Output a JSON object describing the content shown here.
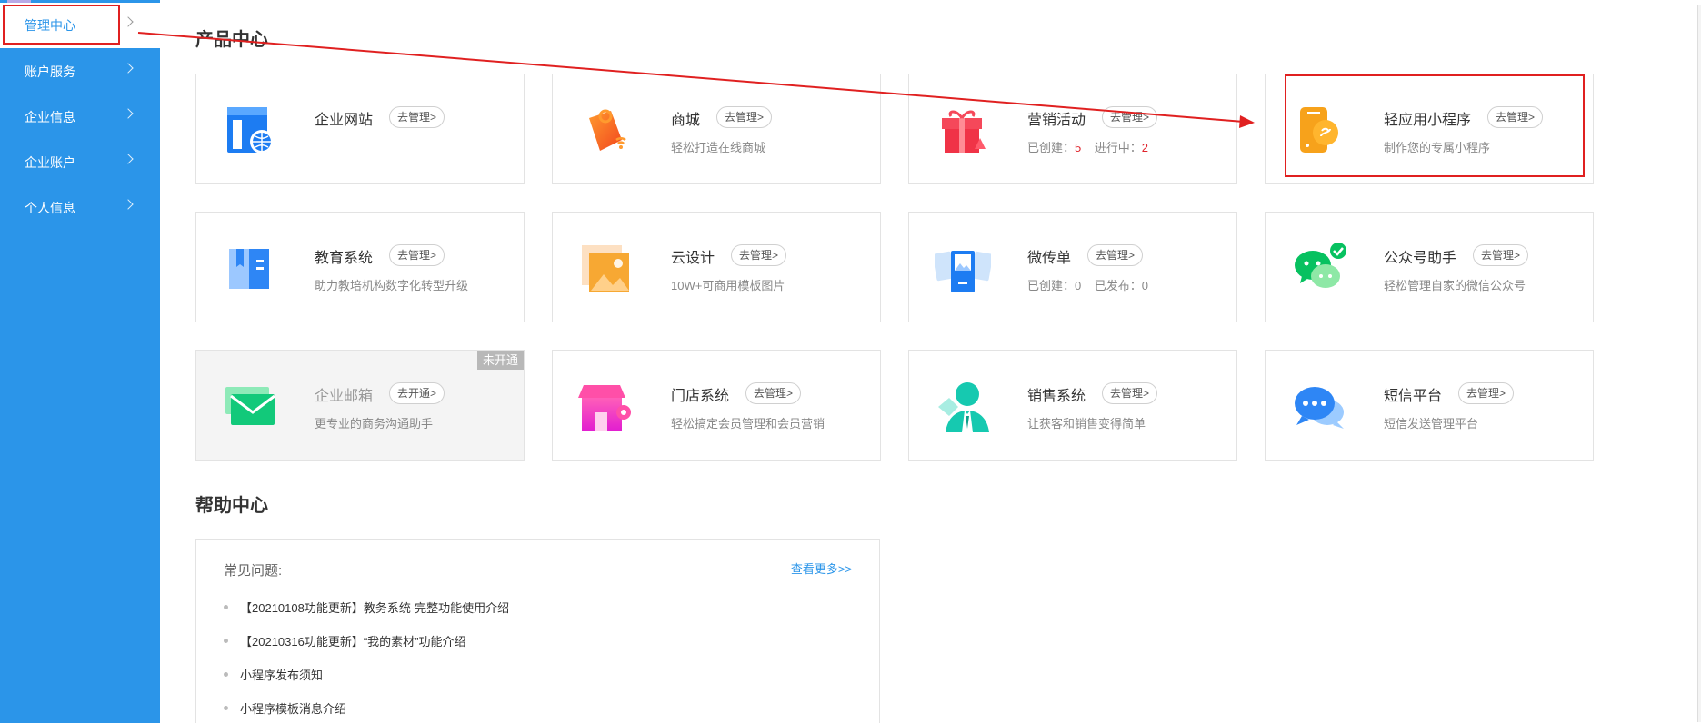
{
  "sidebar": {
    "items": [
      {
        "label": "管理中心"
      },
      {
        "label": "账户服务"
      },
      {
        "label": "企业信息"
      },
      {
        "label": "企业账户"
      },
      {
        "label": "个人信息"
      }
    ]
  },
  "products": {
    "title": "产品中心",
    "cards": [
      {
        "name": "企业网站",
        "action": "去管理>",
        "desc": "",
        "icon": "website-icon"
      },
      {
        "name": "商城",
        "action": "去管理>",
        "desc": "轻松打造在线商城",
        "icon": "shop-tag-icon"
      },
      {
        "name": "营销活动",
        "action": "去管理>",
        "created_label": "已创建：",
        "created": "5",
        "running_label": "进行中：",
        "running": "2",
        "icon": "gift-icon"
      },
      {
        "name": "轻应用小程序",
        "action": "去管理>",
        "desc": "制作您的专属小程序",
        "icon": "mini-program-icon"
      },
      {
        "name": "教育系统",
        "action": "去管理>",
        "desc": "助力教培机构数字化转型升级",
        "icon": "book-icon"
      },
      {
        "name": "云设计",
        "action": "去管理>",
        "desc": "10W+可商用模板图片",
        "icon": "image-design-icon"
      },
      {
        "name": "微传单",
        "action": "去管理>",
        "created_label": "已创建：",
        "created": "0",
        "published_label": "已发布：",
        "published": "0",
        "icon": "flyer-icon"
      },
      {
        "name": "公众号助手",
        "action": "去管理>",
        "desc": "轻松管理自家的微信公众号",
        "icon": "wechat-icon"
      },
      {
        "name": "企业邮箱",
        "action": "去开通>",
        "desc": "更专业的商务沟通助手",
        "badge": "未开通",
        "icon": "mail-icon"
      },
      {
        "name": "门店系统",
        "action": "去管理>",
        "desc": "轻松搞定会员管理和会员营销",
        "icon": "store-icon"
      },
      {
        "name": "销售系统",
        "action": "去管理>",
        "desc": "让获客和销售变得简单",
        "icon": "sales-person-icon"
      },
      {
        "name": "短信平台",
        "action": "去管理>",
        "desc": "短信发送管理平台",
        "icon": "sms-chat-icon"
      }
    ]
  },
  "help": {
    "title": "帮助中心",
    "faq_label": "常见问题:",
    "more": "查看更多>>",
    "items": [
      "【20210108功能更新】教务系统-完整功能使用介绍",
      "【20210316功能更新】“我的素材”功能介绍",
      "小程序发布须知",
      "小程序模板消息介绍"
    ]
  },
  "colors": {
    "sidebar": "#2b95e9",
    "annotation": "#e02020",
    "highlight_number": "#e0242c"
  }
}
